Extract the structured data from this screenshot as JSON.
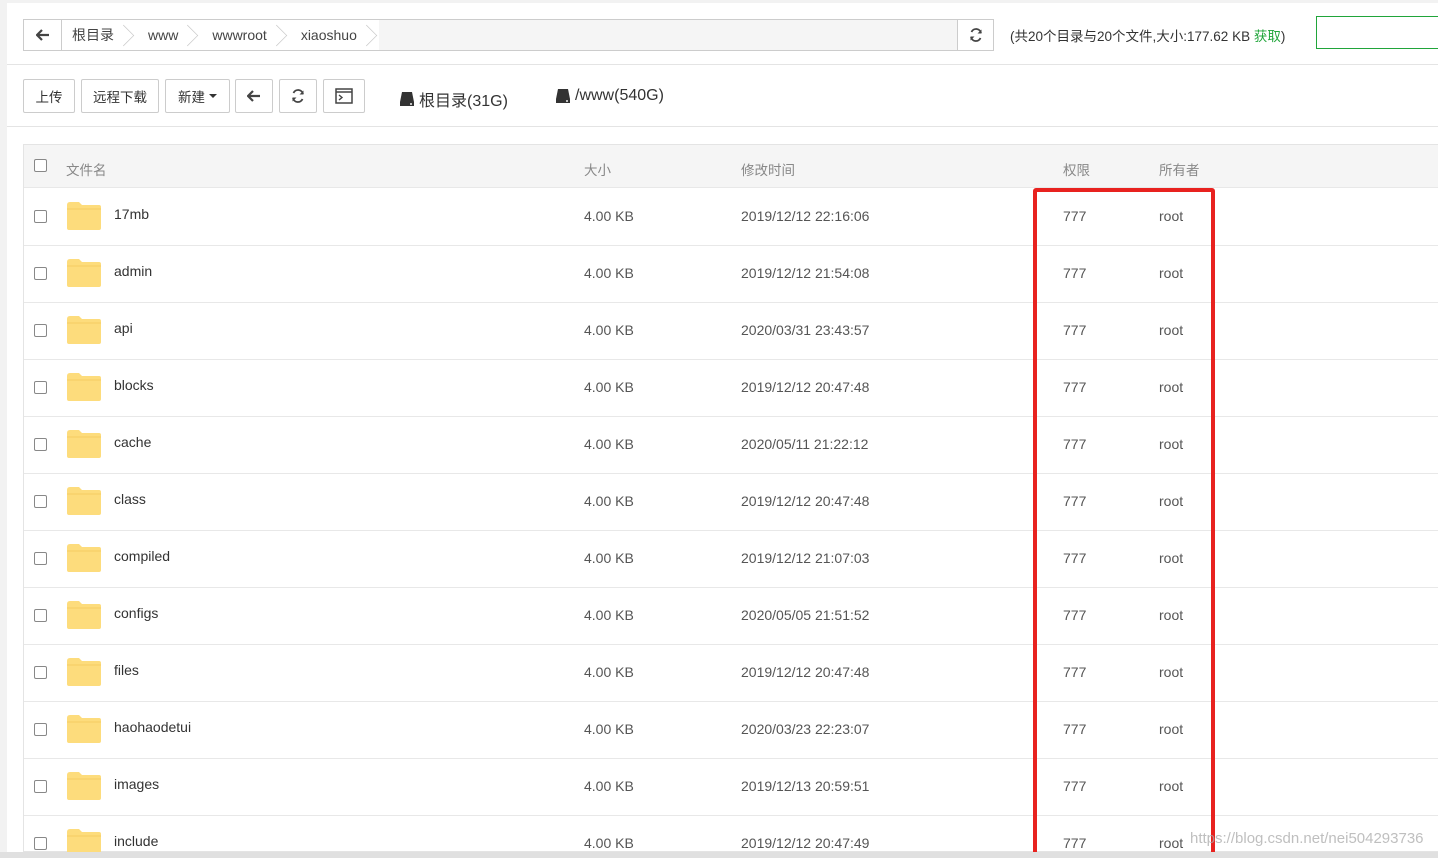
{
  "address": {
    "breadcrumbs": [
      "根目录",
      "www",
      "wwwroot",
      "xiaoshuo"
    ],
    "summary_prefix": "(共20个目录与20个文件,大小:177.62 KB ",
    "fetch_label": "获取",
    "summary_suffix": ")"
  },
  "toolbar": {
    "upload": "上传",
    "remote_download": "远程下载",
    "new": "新建",
    "disks": [
      {
        "label": "根目录(31G)"
      },
      {
        "label": "/www(540G)"
      }
    ]
  },
  "table": {
    "headers": {
      "name": "文件名",
      "size": "大小",
      "mtime": "修改时间",
      "perm": "权限",
      "owner": "所有者"
    },
    "rows": [
      {
        "name": "17mb",
        "size": "4.00 KB",
        "mtime": "2019/12/12 22:16:06",
        "perm": "777",
        "owner": "root"
      },
      {
        "name": "admin",
        "size": "4.00 KB",
        "mtime": "2019/12/12 21:54:08",
        "perm": "777",
        "owner": "root"
      },
      {
        "name": "api",
        "size": "4.00 KB",
        "mtime": "2020/03/31 23:43:57",
        "perm": "777",
        "owner": "root"
      },
      {
        "name": "blocks",
        "size": "4.00 KB",
        "mtime": "2019/12/12 20:47:48",
        "perm": "777",
        "owner": "root"
      },
      {
        "name": "cache",
        "size": "4.00 KB",
        "mtime": "2020/05/11 21:22:12",
        "perm": "777",
        "owner": "root"
      },
      {
        "name": "class",
        "size": "4.00 KB",
        "mtime": "2019/12/12 20:47:48",
        "perm": "777",
        "owner": "root"
      },
      {
        "name": "compiled",
        "size": "4.00 KB",
        "mtime": "2019/12/12 21:07:03",
        "perm": "777",
        "owner": "root"
      },
      {
        "name": "configs",
        "size": "4.00 KB",
        "mtime": "2020/05/05 21:51:52",
        "perm": "777",
        "owner": "root"
      },
      {
        "name": "files",
        "size": "4.00 KB",
        "mtime": "2019/12/12 20:47:48",
        "perm": "777",
        "owner": "root"
      },
      {
        "name": "haohaodetui",
        "size": "4.00 KB",
        "mtime": "2020/03/23 22:23:07",
        "perm": "777",
        "owner": "root"
      },
      {
        "name": "images",
        "size": "4.00 KB",
        "mtime": "2019/12/13 20:59:51",
        "perm": "777",
        "owner": "root"
      },
      {
        "name": "include",
        "size": "4.00 KB",
        "mtime": "2019/12/12 20:47:49",
        "perm": "777",
        "owner": "root"
      }
    ]
  },
  "watermark": "https://blog.csdn.net/nei504293736",
  "colors": {
    "accent": "#20a53a",
    "highlight": "#e8221f",
    "folder": "#fddc7c"
  }
}
